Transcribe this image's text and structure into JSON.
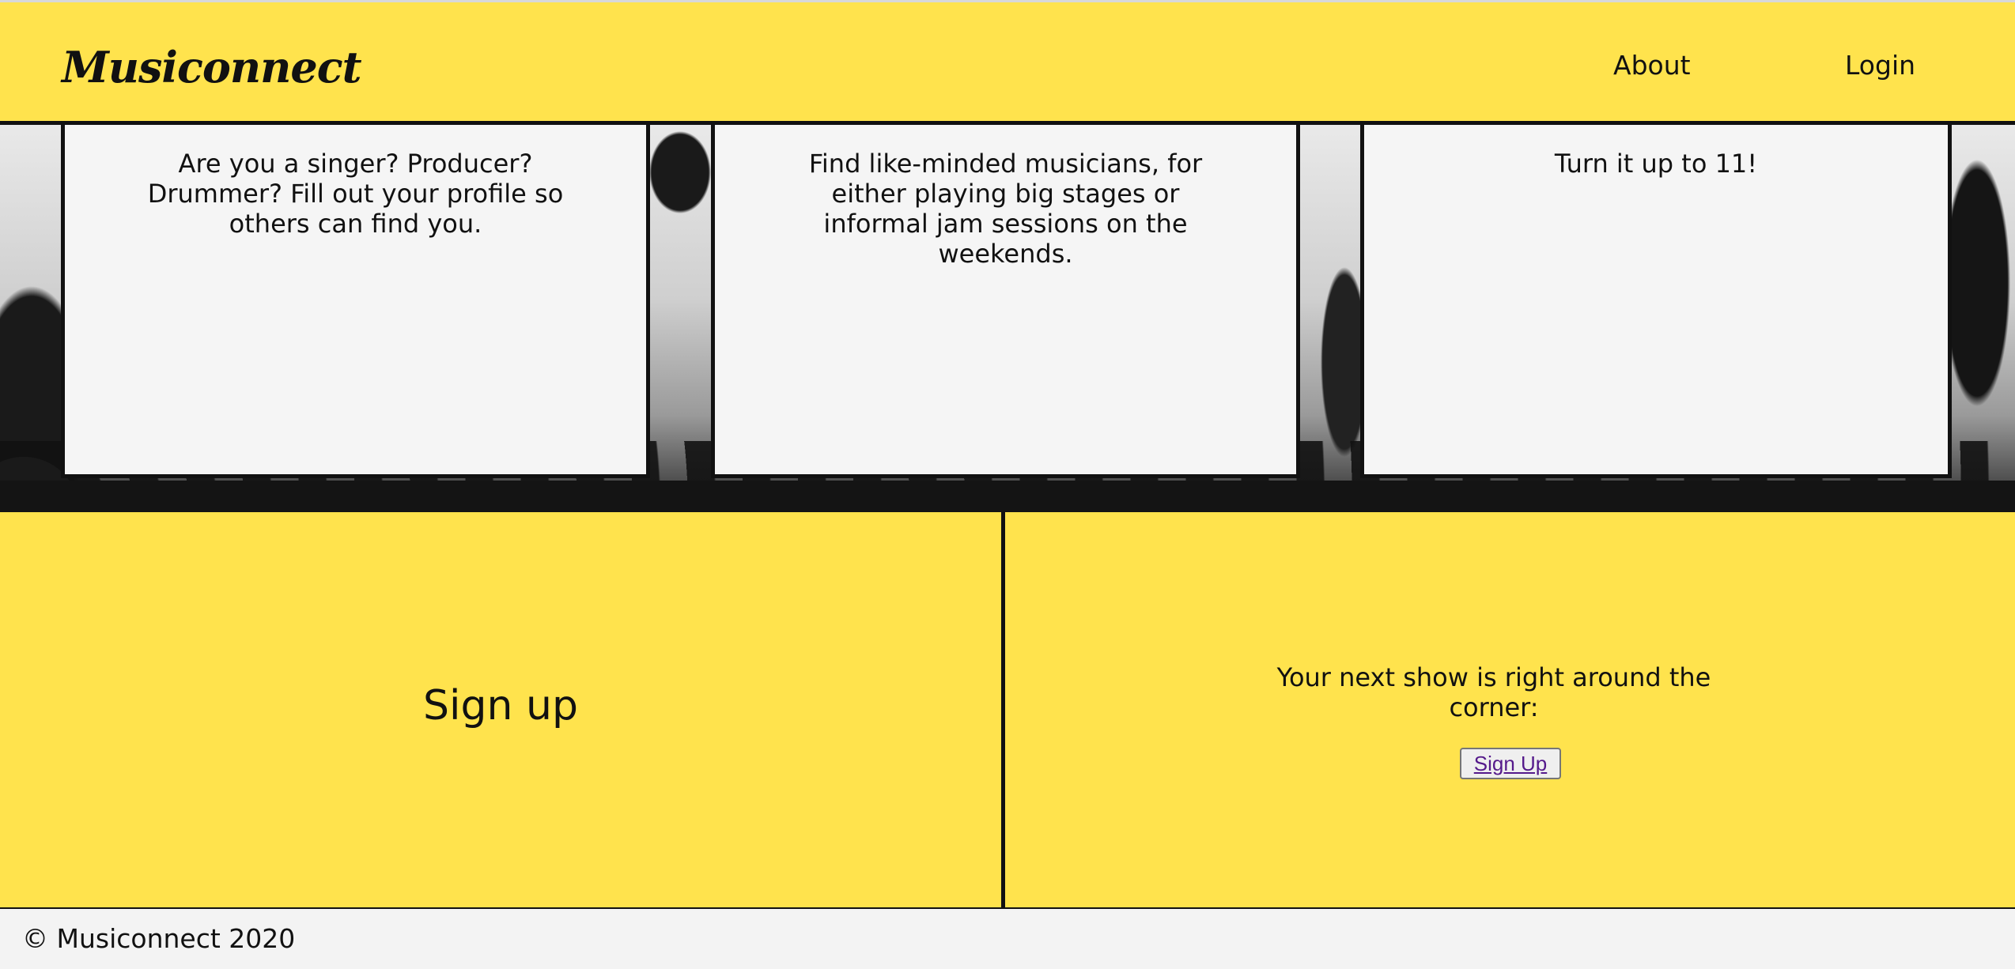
{
  "header": {
    "logo": "Musiconnect",
    "nav": {
      "about": "About",
      "login": "Login"
    }
  },
  "hero": {
    "cards": [
      "Are you a singer? Producer? Drummer? Fill out your profile so others can find you.",
      "Find like-minded musicians, for either playing big stages or informal jam sessions on the weekends.",
      "Turn it up to 11!"
    ]
  },
  "signup": {
    "heading": "Sign up",
    "text": "Your next show is right around the corner:",
    "button_label": "Sign Up"
  },
  "footer": {
    "copyright": "© Musiconnect 2020"
  },
  "colors": {
    "primary_yellow": "#ffe34d",
    "border": "#111111",
    "card_background": "#f5f5f5",
    "link_visited": "#551a8b"
  }
}
